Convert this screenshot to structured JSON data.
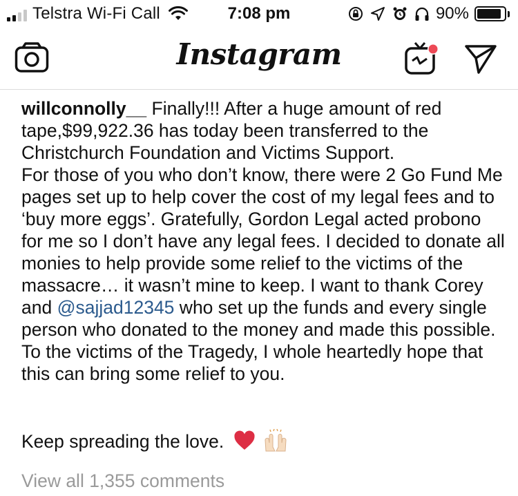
{
  "status_bar": {
    "carrier": "Telstra Wi-Fi Call",
    "time": "7:08 pm",
    "battery_percent": "90%",
    "battery_level": 0.9,
    "icons": [
      "signal-icon",
      "wifi-icon",
      "screen-rotation-lock-icon",
      "location-arrow-icon",
      "alarm-icon",
      "headphones-icon",
      "battery-icon"
    ]
  },
  "nav": {
    "logo": "Instagram",
    "icons": [
      "camera-icon",
      "igtv-icon",
      "direct-message-icon"
    ],
    "notification_color": "#ed4956"
  },
  "post": {
    "username": "willconnolly__",
    "line1": "Finally!!! After a huge amount of red tape,$99,922.36 has today been transferred to the Christchurch Foundation and Victims Support.",
    "line2_before": "For those of you who don’t know, there were 2 Go Fund Me pages set up to help cover the cost of my legal fees and to ‘buy more eggs’. Gratefully, Gordon Legal acted probono for me so I don’t have any legal fees. I decided to donate all monies to help provide some relief to the victims of the massacre… it wasn’t mine to keep. I want to thank Corey  and",
    "mention": "@sajjad12345",
    "line2_after": " who set up the funds and every single person who donated to the money and made this possible. To the victims of the Tragedy, I whole heartedly hope that this can bring some relief to you.",
    "closing": "Keep spreading the love.",
    "emojis": [
      "heart-emoji",
      "raising-hands-emoji"
    ],
    "mention_color": "#2b5a8d"
  },
  "comments": {
    "view_all": "View all 1,355 comments"
  }
}
